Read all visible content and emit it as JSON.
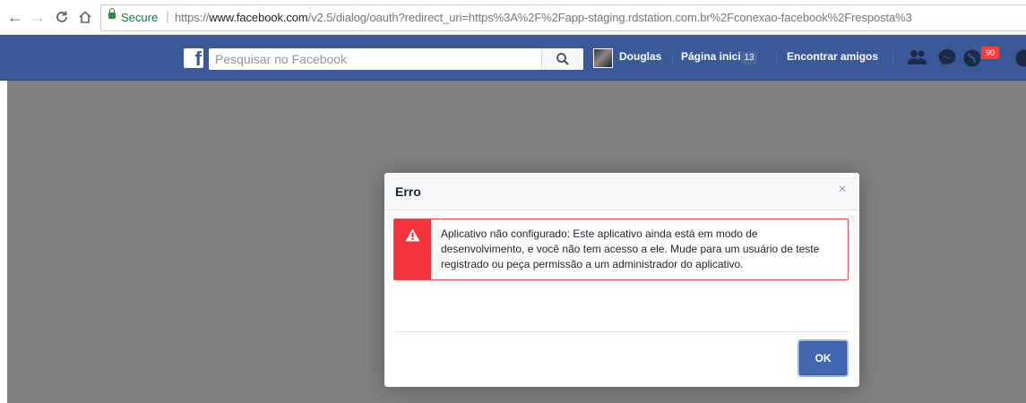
{
  "browser": {
    "back_icon": "arrow-left-icon",
    "forward_icon": "arrow-right-icon",
    "reload_icon": "reload-icon",
    "home_icon": "home-icon",
    "secure_label": "Secure",
    "url_separator": "|",
    "url_scheme": "https://",
    "url_host": "www.facebook.com",
    "url_path": "/v2.5/dialog/oauth?redirect_uri=https%3A%2F%2Fapp-staging.rdstation.com.br%2Fconexao-facebook%2Fresposta%3"
  },
  "facebook": {
    "logo_letter": "f",
    "search_placeholder": "Pesquisar no Facebook",
    "user_name": "Douglas",
    "home_label": "Página inicial",
    "home_count": "13",
    "find_friends_label": "Encontrar amigos",
    "notifications_count": "90",
    "brand_color": "#3b5998"
  },
  "dialog": {
    "title": "Erro",
    "close_symbol": "×",
    "error_message": "Aplicativo não configurado: Este aplicativo ainda está em modo de desenvolvimento, e você não tem acesso a ele. Mude para um usuário de teste registrado ou peça permissão a um administrador do aplicativo.",
    "ok_label": "OK",
    "error_color": "#f2333a"
  }
}
